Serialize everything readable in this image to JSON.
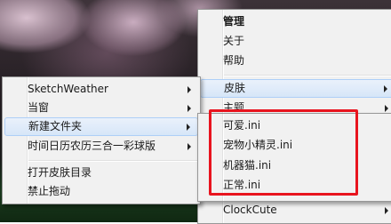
{
  "menu_top": {
    "items": [
      {
        "label": "管理",
        "bold": true
      },
      {
        "label": "关于"
      },
      {
        "label": "帮助"
      },
      {
        "label": "皮肤",
        "submenu": true,
        "highlighted": true
      },
      {
        "label": "主题",
        "submenu": true
      },
      {
        "label": "ClockCute",
        "submenu": true
      }
    ]
  },
  "menu_left": {
    "items": [
      {
        "label": "SketchWeather",
        "submenu": true
      },
      {
        "label": "当窗",
        "submenu": true
      },
      {
        "label": "新建文件夹",
        "submenu": true,
        "highlighted": true
      },
      {
        "label": "时间日历农历三合一彩球版",
        "submenu": true
      },
      {
        "label": "打开皮肤目录"
      },
      {
        "label": "禁止拖动"
      }
    ]
  },
  "menu_sub": {
    "items": [
      {
        "label": "可爱.ini"
      },
      {
        "label": "宠物小精灵.ini"
      },
      {
        "label": "机器猫.ini"
      },
      {
        "label": "正常.ini"
      }
    ]
  },
  "colors": {
    "highlight_border": "#e8141e",
    "menu_bg": "#f1f1f1"
  }
}
